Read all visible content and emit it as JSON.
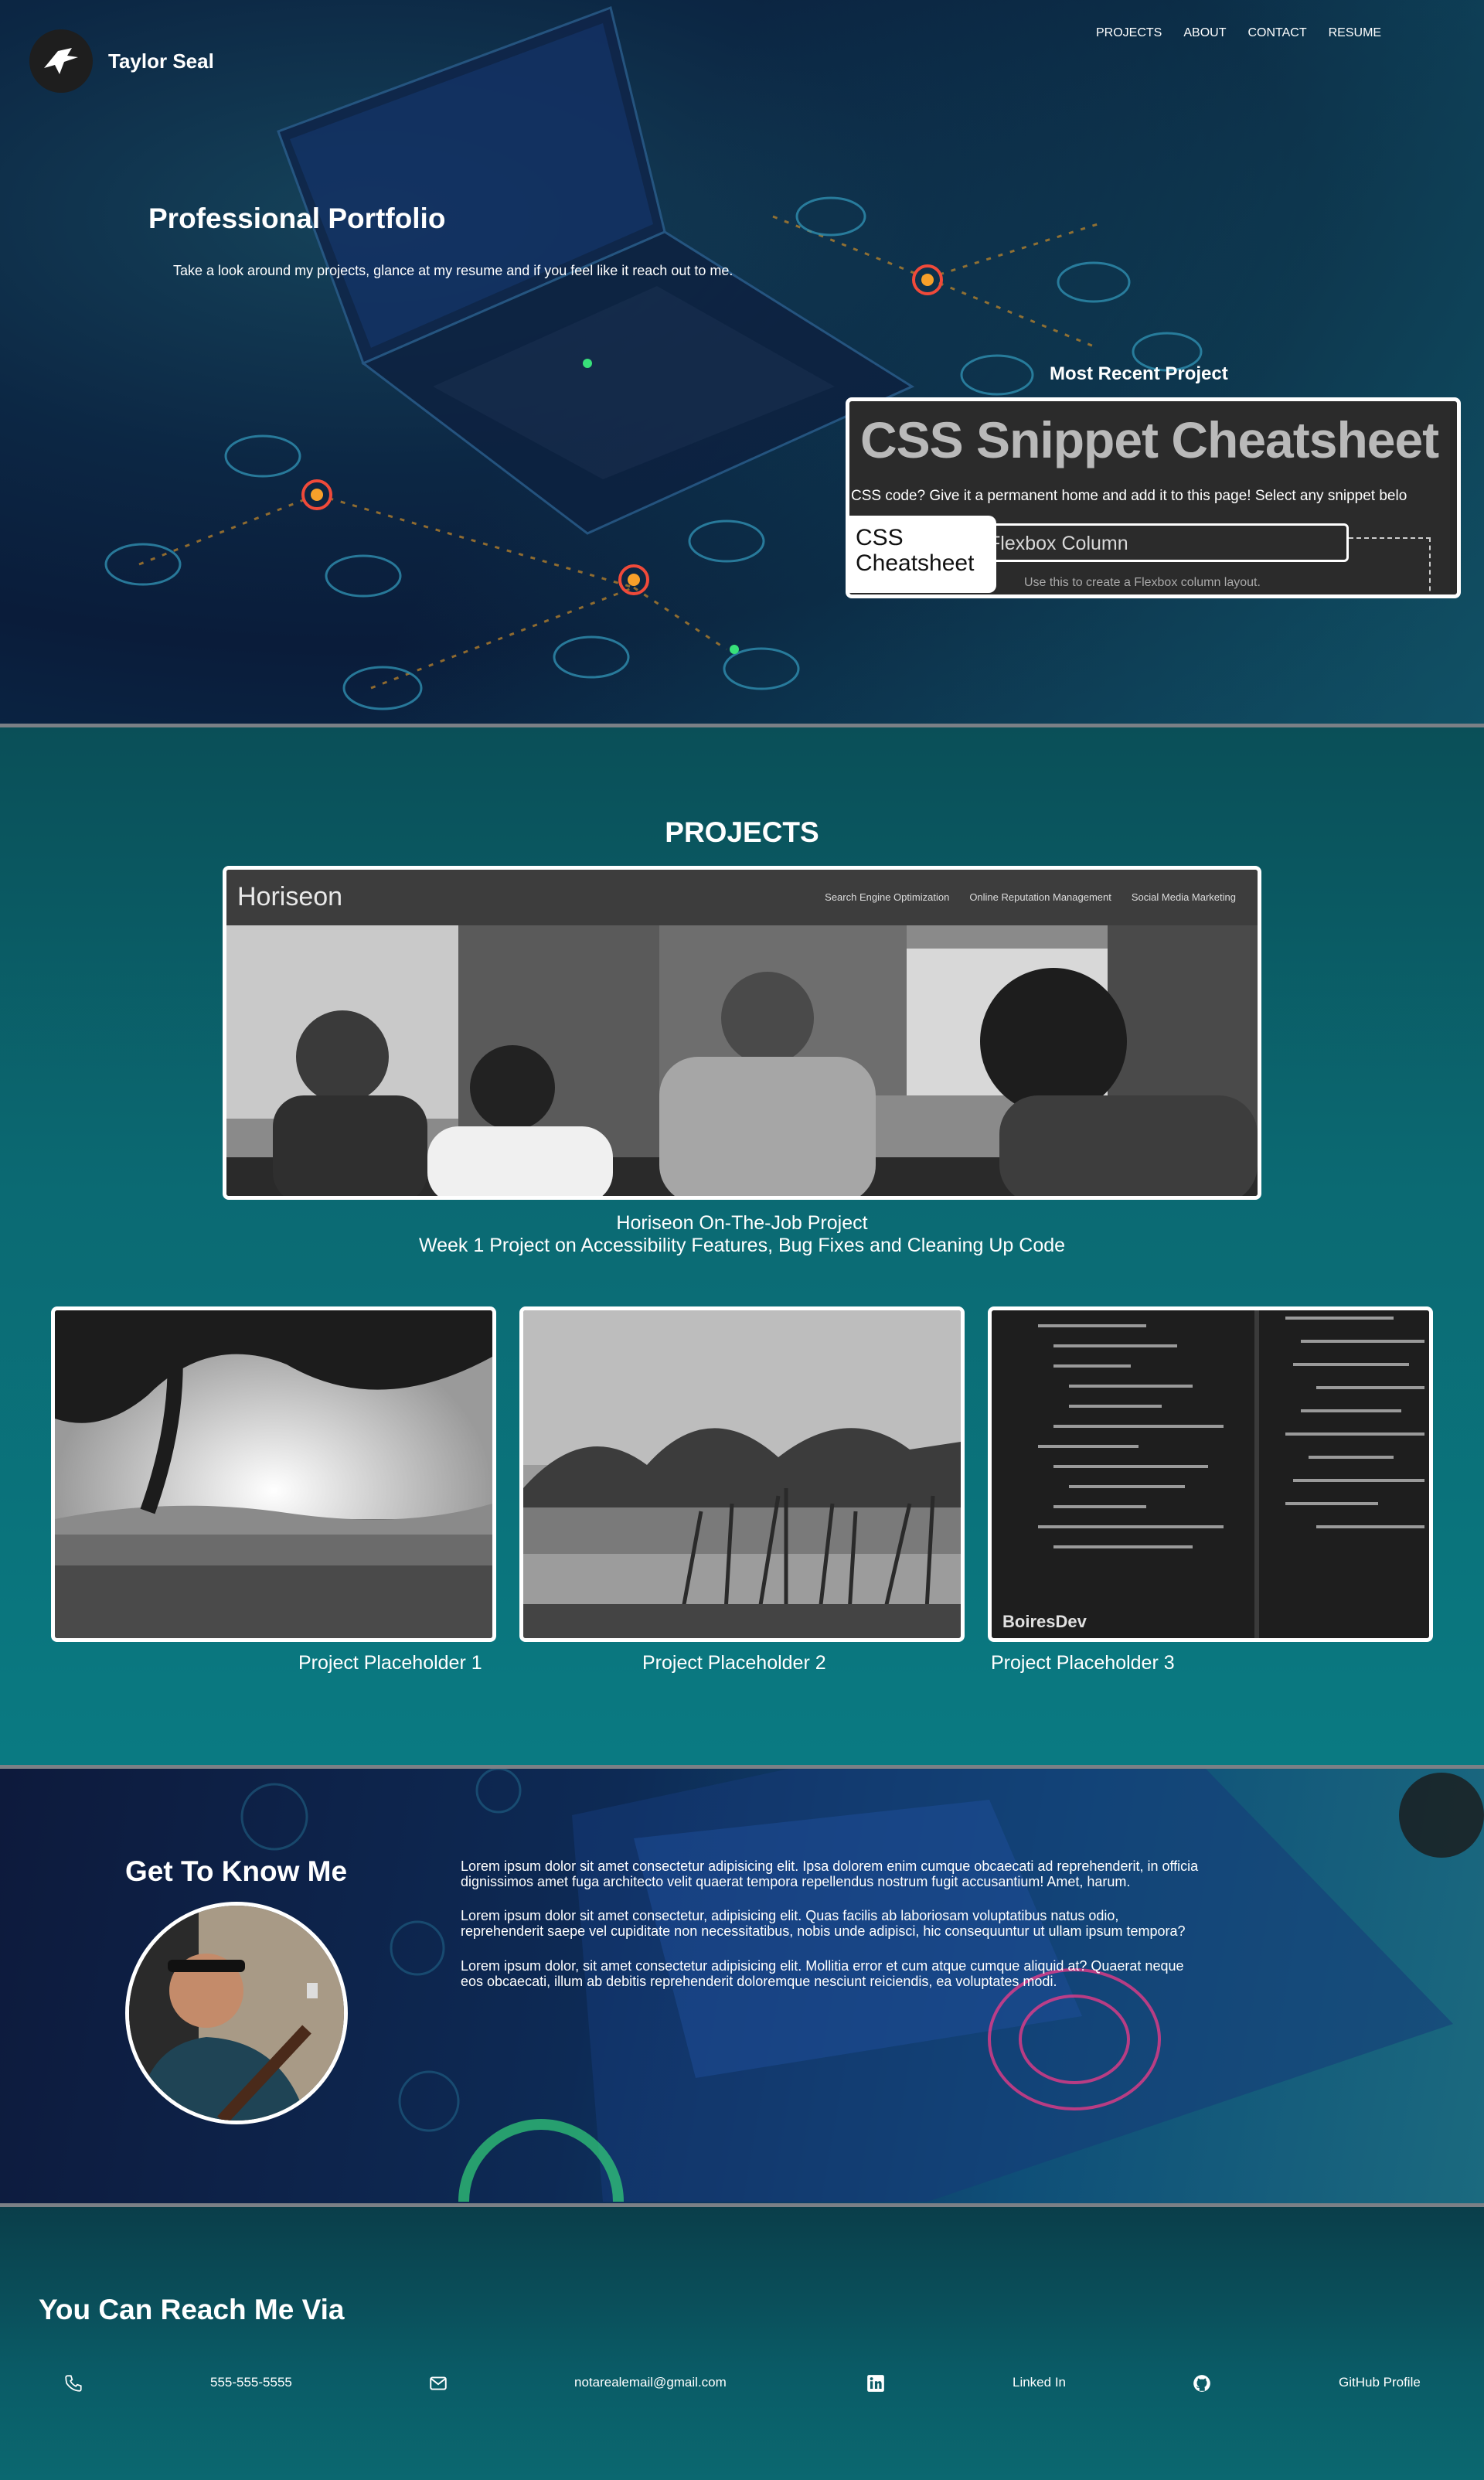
{
  "header": {
    "brand_name": "Taylor Seal",
    "nav": [
      "PROJECTS",
      "ABOUT",
      "CONTACT",
      "RESUME"
    ]
  },
  "hero": {
    "title": "Professional Portfolio",
    "subtitle": "Take a look around my projects, glance at my resume and if you feel like it reach out to me.",
    "recent_label": "Most Recent Project",
    "recent_card": {
      "heading": "CSS Snippet Cheatsheet",
      "text": "CSS code? Give it a permanent home and add it to this page! Select any snippet belo",
      "box_label": "Flexbox Column",
      "hint": "Use this to create a Flexbox column layout.",
      "tag": "CSS Cheatsheet"
    }
  },
  "projects": {
    "title": "PROJECTS",
    "feature": {
      "brand": "Horiseon",
      "links": [
        "Search Engine Optimization",
        "Online Reputation Management",
        "Social Media Marketing"
      ],
      "caption_line1": "Horiseon On-The-Job Project",
      "caption_line2": "Week 1 Project on Accessibility Features, Bug Fixes and Cleaning Up Code"
    },
    "placeholders": [
      "Project Placeholder 1",
      "Project Placeholder 2",
      "Project Placeholder 3"
    ],
    "thumb3_watermark": "BoiresDev"
  },
  "about": {
    "title": "Get To Know Me",
    "paragraphs": [
      "Lorem ipsum dolor sit amet consectetur adipisicing elit. Ipsa dolorem enim cumque obcaecati ad reprehenderit, in officia dignissimos amet fuga architecto velit quaerat tempora repellendus nostrum fugit accusantium! Amet, harum.",
      "Lorem ipsum dolor sit amet consectetur, adipisicing elit. Quas facilis ab laboriosam voluptatibus natus odio, reprehenderit saepe vel cupiditate non necessitatibus, nobis unde adipisci, hic consequuntur ut ullam ipsum tempora?",
      "Lorem ipsum dolor, sit amet consectetur adipisicing elit. Mollitia error et cum atque cumque aliquid at? Quaerat neque eos obcaecati, illum ab debitis reprehenderit doloremque nesciunt reiciendis, ea voluptates modi."
    ]
  },
  "contact": {
    "title": "You Can Reach Me Via",
    "phone": "555-555-5555",
    "email": "notarealemail@gmail.com",
    "linkedin": "Linked In",
    "github": "GitHub Profile"
  }
}
